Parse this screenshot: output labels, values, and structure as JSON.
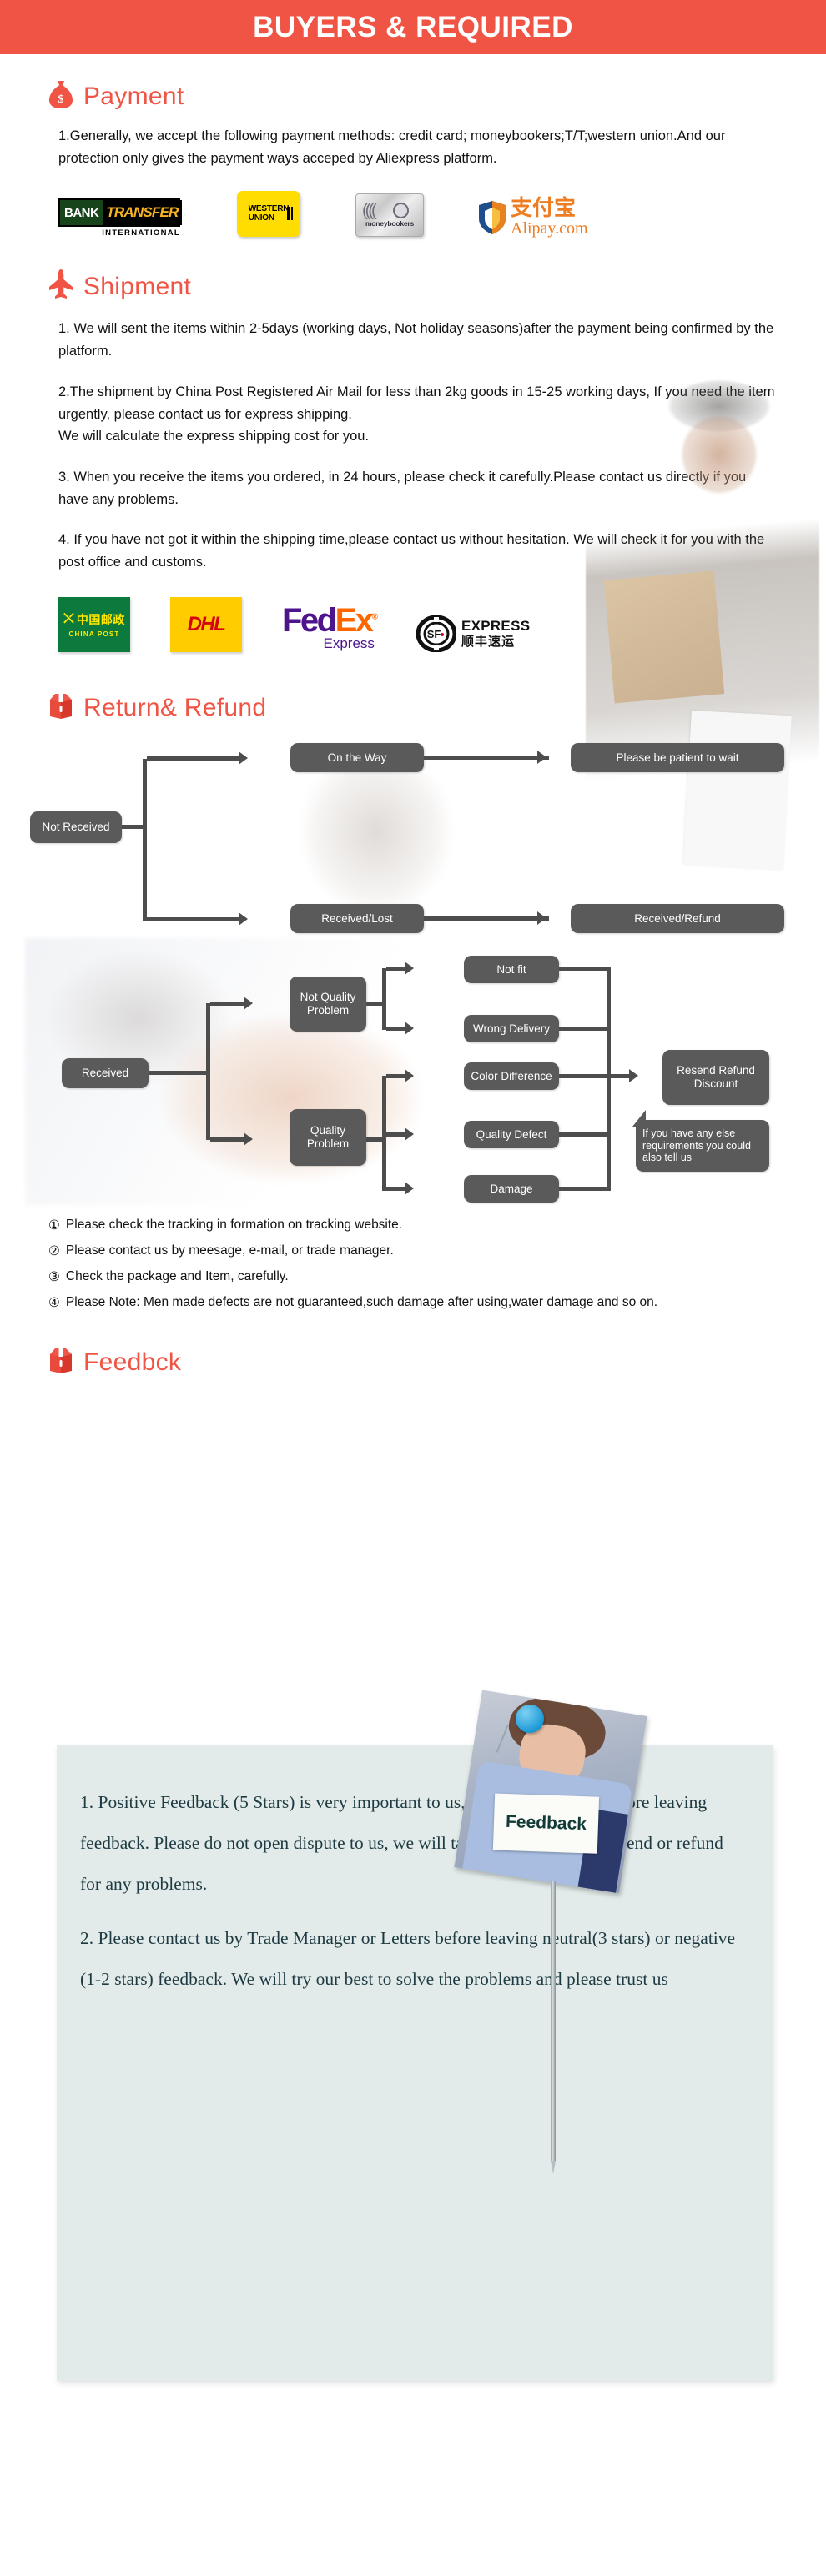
{
  "banner": {
    "title": "BUYERS & REQUIRED"
  },
  "theme": {
    "accent": "#ef5444",
    "node_bg": "#5a5a5a",
    "feedback_panel_bg": "#e2ebe9",
    "feedback_text": "#1d3a42"
  },
  "payment": {
    "heading": "Payment",
    "icon": "money-bag-icon",
    "body": "1.Generally, we accept the following payment methods: credit card; moneybookers;T/T;western union.And our protection only gives the payment ways acceped by Aliexpress platform.",
    "logos": [
      {
        "id": "bank-transfer",
        "primary": "BANK",
        "secondary": "TRANSFER",
        "sub": "INTERNATIONAL"
      },
      {
        "id": "western-union",
        "line1": "WESTERN",
        "line2": "UNION"
      },
      {
        "id": "moneybookers",
        "label": "moneybookers"
      },
      {
        "id": "alipay",
        "cn": "支付宝",
        "domain": "Alipay.com"
      }
    ]
  },
  "shipment": {
    "heading": "Shipment",
    "icon": "airplane-icon",
    "paragraphs": [
      "1. We will sent the items within 2-5days (working days, Not holiday seasons)after the payment being confirmed by the platform.",
      "2.The shipment by China Post Registered Air Mail for less than  2kg goods in 15-25 working days, If  you need the item urgently, please contact us for express shipping.\nWe will calculate the express shipping cost for you.",
      "3. When you receive the items you ordered, in 24 hours, please check  it carefully.Please contact us directly if you have any problems.",
      "4. If you have not got it within the shipping time,please contact us without hesitation. We will check it for you with the post office and customs."
    ],
    "logos": [
      {
        "id": "china-post",
        "cn": "中国邮政",
        "en": "CHINA POST"
      },
      {
        "id": "dhl",
        "label": "DHL"
      },
      {
        "id": "fedex",
        "part1": "Fed",
        "part2": "Ex",
        "sub": "Express"
      },
      {
        "id": "sf-express",
        "badge": "SF",
        "en": "EXPRESS",
        "cn": "顺丰速运"
      }
    ]
  },
  "return_refund": {
    "heading": "Return& Refund",
    "icon": "gift-box-icon",
    "flow_not_received": {
      "root": "Not Received",
      "branches": [
        {
          "step": "On the Way",
          "result": "Please be patient to wait"
        },
        {
          "step": "Received/Lost",
          "result": "Received/Refund"
        }
      ]
    },
    "flow_received": {
      "root": "Received",
      "categories": [
        {
          "name": "Not Quality Problem",
          "reasons": [
            "Not fit",
            "Wrong Delivery"
          ]
        },
        {
          "name": "Quality Problem",
          "reasons": [
            "Color Difference",
            "Quality Defect",
            "Damage"
          ]
        }
      ],
      "outcome": "Resend Refund Discount",
      "callout": "If you have any else requirements you could also tell us"
    },
    "notes": [
      {
        "marker": "①",
        "text": "Please check the tracking in formation on tracking website."
      },
      {
        "marker": "②",
        "text": "Please contact us by meesage, e-mail, or trade manager."
      },
      {
        "marker": "③",
        "text": "Check the package and Item, carefully."
      },
      {
        "marker": "④",
        "text": "Please Note: Men made defects  are not guaranteed,such damage after using,water damage and so on."
      }
    ]
  },
  "feedback": {
    "heading": "Feedbck",
    "icon": "gift-box-icon",
    "photo_sign_label": "Feedback",
    "paragraphs": [
      "1. Positive Feedback (5 Stars) is very important to us, please think twice before leaving feedback. Please do not open dispute to us,   we will take responsibility to resend or refund for any problems.",
      "2. Please contact us by Trade Manager or Letters before leaving neutral(3 stars) or negative (1-2 stars) feedback. We will try our best to solve the problems and please trust us"
    ]
  }
}
